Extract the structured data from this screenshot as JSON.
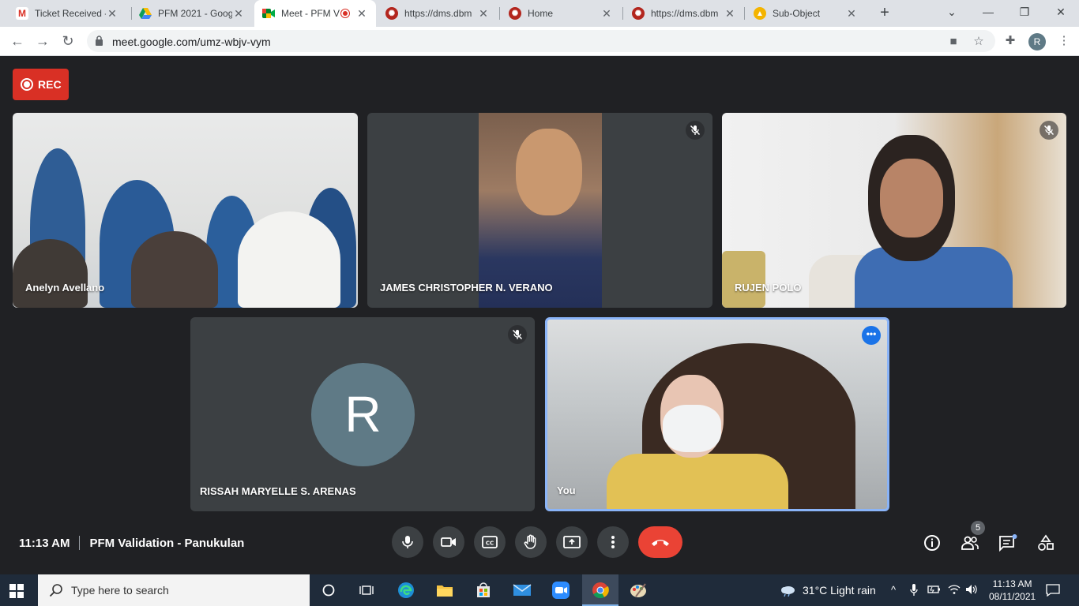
{
  "browser": {
    "tabs": [
      {
        "title": "Ticket Received -",
        "favicon": "gmail-icon"
      },
      {
        "title": "PFM 2021 - Goog",
        "favicon": "drive-icon"
      },
      {
        "title": "Meet - PFM V",
        "favicon": "meet-icon",
        "active": true,
        "recording": true
      },
      {
        "title": "https://dms.dbm",
        "favicon": "dms-icon"
      },
      {
        "title": "Home",
        "favicon": "dms-icon"
      },
      {
        "title": "https://dms.dbm",
        "favicon": "dms-icon"
      },
      {
        "title": "Sub-Object",
        "favicon": "sub-object-icon"
      }
    ],
    "new_tab": "+",
    "url": "meet.google.com/umz-wbjv-vym",
    "profile_initial": "R"
  },
  "meet": {
    "rec_label": "REC",
    "tiles": [
      {
        "name": "Anelyn Avellano",
        "muted": false
      },
      {
        "name": "JAMES CHRISTOPHER N. VERANO",
        "muted": true
      },
      {
        "name": "RUJEN POLO",
        "muted": true
      },
      {
        "name": "RISSAH MARYELLE S. ARENAS",
        "muted": true,
        "avatar": "R"
      },
      {
        "name": "You",
        "muted": false,
        "more": "•••"
      }
    ],
    "time": "11:13 AM",
    "meeting_title": "PFM Validation - Panukulan",
    "participants_count": "5"
  },
  "taskbar": {
    "search_placeholder": "Type here to search",
    "weather": "31°C  Light rain",
    "time": "11:13 AM",
    "date": "08/11/2021"
  },
  "colors": {
    "rec_red": "#d93025",
    "end_call": "#ea4335",
    "focus_blue": "#8ab4f8",
    "meet_bg": "#202124"
  }
}
